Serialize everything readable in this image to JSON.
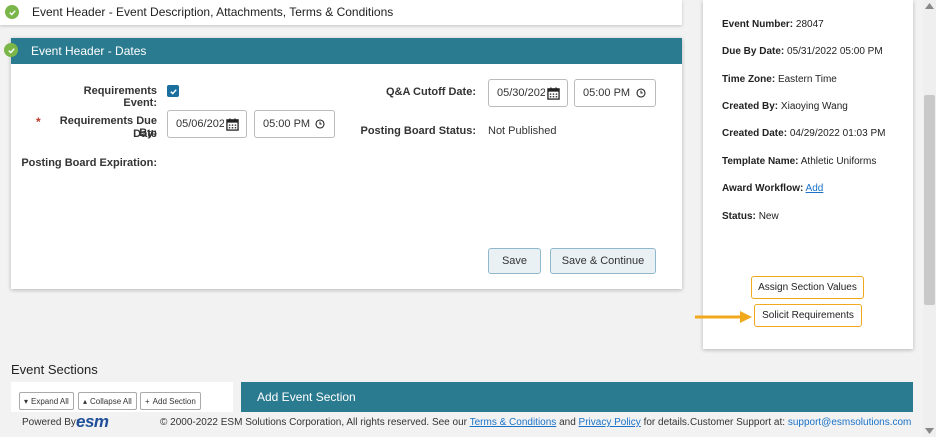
{
  "top_card": {
    "title": "Event Header - Event Description, Attachments, Terms & Conditions"
  },
  "dates_card": {
    "title": "Event Header - Dates",
    "requirements_event_label": "Requirements Event:",
    "requirements_event_checked": true,
    "required_marker": "*",
    "due_by_label_1": "Requirements Due By:",
    "due_by_label_2": "Date",
    "due_date_value": "05/06/2022",
    "due_time_value": "05:00 PM",
    "posting_expiration_label": "Posting Board Expiration:",
    "qa_cutoff_label": "Q&A Cutoff Date:",
    "qa_date_value": "05/30/2022",
    "qa_time_value": "05:00 PM",
    "posting_status_label": "Posting Board Status:",
    "posting_status_value": "Not Published",
    "save_label": "Save",
    "save_continue_label": "Save & Continue"
  },
  "info_panel": {
    "event_number_label": "Event Number:",
    "event_number_value": "28047",
    "due_by_label": "Due By Date:",
    "due_by_value": "05/31/2022 05:00 PM",
    "time_zone_label": "Time Zone:",
    "time_zone_value": "Eastern Time",
    "created_by_label": "Created By:",
    "created_by_value": "Xiaoying Wang",
    "created_date_label": "Created Date:",
    "created_date_value": "04/29/2022 01:03 PM",
    "template_label": "Template Name:",
    "template_value": "Athletic Uniforms",
    "award_label": "Award Workflow:",
    "award_link": "Add",
    "status_label": "Status:",
    "status_value": "New",
    "assign_btn": "Assign Section Values",
    "solicit_btn": "Solicit Requirements"
  },
  "sections": {
    "title": "Event Sections",
    "expand_all": "Expand All",
    "collapse_all": "Collapse All",
    "add_section": "Add Section",
    "add_event_section": "Add Event Section"
  },
  "footer": {
    "powered_by": "Powered By:",
    "logo_text": "esm",
    "copyright": "© 2000-2022 ESM Solutions Corporation, All rights reserved. See our",
    "terms_link": "Terms & Conditions",
    "and": "and",
    "privacy_link": "Privacy Policy",
    "for_details": "for details.",
    "support_label": "Customer Support at:",
    "support_email": "support@esmsolutions.com"
  },
  "colors": {
    "header_teal": "#2b7b90",
    "accent_orange": "#f2a81d",
    "check_green": "#7ab648",
    "link_blue": "#1a73c8"
  }
}
